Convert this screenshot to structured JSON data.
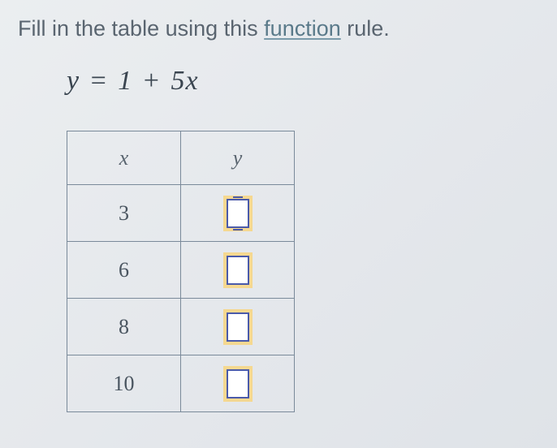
{
  "instruction": {
    "before": "Fill in the table using this ",
    "link": "function",
    "after": " rule."
  },
  "equation": {
    "lhs_var": "y",
    "eq": "=",
    "const": "1",
    "op": "+",
    "coef": "5",
    "rhs_var": "x"
  },
  "table": {
    "headers": {
      "x": "x",
      "y": "y"
    },
    "rows": [
      {
        "x": "3",
        "y": "",
        "active": true
      },
      {
        "x": "6",
        "y": "",
        "active": false
      },
      {
        "x": "8",
        "y": "",
        "active": false
      },
      {
        "x": "10",
        "y": "",
        "active": false
      }
    ]
  }
}
